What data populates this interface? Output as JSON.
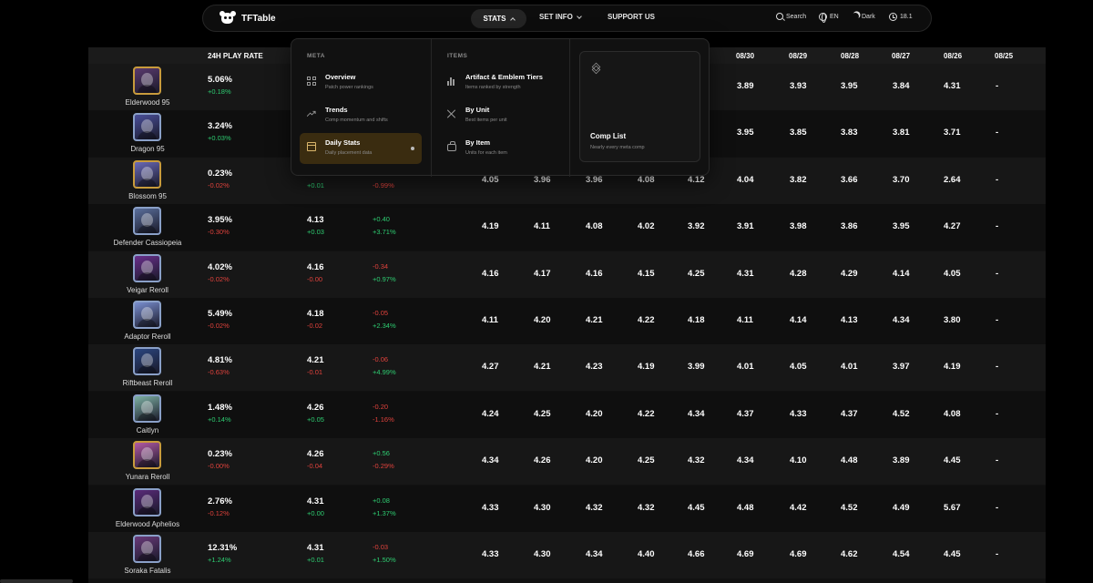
{
  "navbar": {
    "logo": "TFTable",
    "stats": "STATS",
    "set_info": "SET INFO",
    "support": "SUPPORT US",
    "search": "Search",
    "lang": "EN",
    "theme": "Dark",
    "version": "18.1"
  },
  "table": {
    "headers": {
      "play_rate": "24H PLAY RATE",
      "dates": [
        "08/30",
        "08/29",
        "08/28",
        "08/27",
        "08/26",
        "08/25"
      ]
    },
    "rows": [
      {
        "name": "Elderwood 95",
        "play": "5.06%",
        "play_delta": "+0.18%",
        "place": "",
        "place_delta": "",
        "change": "",
        "change_pct": "",
        "d": [
          "",
          "",
          "",
          "",
          "",
          "3.89",
          "3.93",
          "3.95",
          "3.84",
          "4.31",
          "-"
        ]
      },
      {
        "name": "Dragon 95",
        "play": "3.24%",
        "play_delta": "+0.03%",
        "place": "",
        "place_delta": "",
        "change": "",
        "change_pct": "",
        "d": [
          "",
          "",
          "",
          "",
          "",
          "3.95",
          "3.85",
          "3.83",
          "3.81",
          "3.71",
          "-"
        ]
      },
      {
        "name": "Blossom 95",
        "play": "0.23%",
        "play_delta": "-0.02%",
        "place": "",
        "place_delta": "+0.01",
        "change": "",
        "change_pct": "-0.99%",
        "d": [
          "4.05",
          "3.96",
          "3.96",
          "4.08",
          "4.12",
          "4.04",
          "3.82",
          "3.66",
          "3.70",
          "2.64",
          "-"
        ]
      },
      {
        "name": "Defender Cassiopeia",
        "play": "3.95%",
        "play_delta": "-0.30%",
        "place": "4.13",
        "place_delta": "+0.03",
        "change": "+0.40",
        "change_pct": "+3.71%",
        "d": [
          "4.19",
          "4.11",
          "4.08",
          "4.02",
          "3.92",
          "3.91",
          "3.98",
          "3.86",
          "3.95",
          "4.27",
          "-"
        ]
      },
      {
        "name": "Veigar Reroll",
        "play": "4.02%",
        "play_delta": "-0.02%",
        "place": "4.16",
        "place_delta": "-0.00",
        "change": "-0.34",
        "change_pct": "+0.97%",
        "d": [
          "4.16",
          "4.17",
          "4.16",
          "4.15",
          "4.25",
          "4.31",
          "4.28",
          "4.29",
          "4.14",
          "4.05",
          "-"
        ]
      },
      {
        "name": "Adaptor Reroll",
        "play": "5.49%",
        "play_delta": "-0.02%",
        "place": "4.18",
        "place_delta": "-0.02",
        "change": "-0.05",
        "change_pct": "+2.34%",
        "d": [
          "4.11",
          "4.20",
          "4.21",
          "4.22",
          "4.18",
          "4.11",
          "4.14",
          "4.13",
          "4.34",
          "3.80",
          "-"
        ]
      },
      {
        "name": "Riftbeast Reroll",
        "play": "4.81%",
        "play_delta": "-0.63%",
        "place": "4.21",
        "place_delta": "-0.01",
        "change": "-0.06",
        "change_pct": "+4.99%",
        "d": [
          "4.27",
          "4.21",
          "4.23",
          "4.19",
          "3.99",
          "4.01",
          "4.05",
          "4.01",
          "3.97",
          "4.19",
          "-"
        ]
      },
      {
        "name": "Caitlyn",
        "play": "1.48%",
        "play_delta": "+0.14%",
        "place": "4.26",
        "place_delta": "+0.05",
        "change": "-0.20",
        "change_pct": "-1.16%",
        "d": [
          "4.24",
          "4.25",
          "4.20",
          "4.22",
          "4.34",
          "4.37",
          "4.33",
          "4.37",
          "4.52",
          "4.08",
          "-"
        ]
      },
      {
        "name": "Yunara Reroll",
        "play": "0.23%",
        "play_delta": "-0.00%",
        "place": "4.26",
        "place_delta": "-0.04",
        "change": "+0.56",
        "change_pct": "-0.29%",
        "d": [
          "4.34",
          "4.26",
          "4.20",
          "4.25",
          "4.32",
          "4.34",
          "4.10",
          "4.48",
          "3.89",
          "4.45",
          "-"
        ]
      },
      {
        "name": "Elderwood Aphelios",
        "play": "2.76%",
        "play_delta": "-0.12%",
        "place": "4.31",
        "place_delta": "+0.00",
        "change": "+0.08",
        "change_pct": "+1.37%",
        "d": [
          "4.33",
          "4.30",
          "4.32",
          "4.32",
          "4.45",
          "4.48",
          "4.42",
          "4.52",
          "4.49",
          "5.67",
          "-"
        ]
      },
      {
        "name": "Soraka Fatalis",
        "play": "12.31%",
        "play_delta": "+1.24%",
        "place": "4.31",
        "place_delta": "+0.01",
        "change": "-0.03",
        "change_pct": "+1.50%",
        "d": [
          "4.33",
          "4.30",
          "4.34",
          "4.40",
          "4.66",
          "4.69",
          "4.69",
          "4.62",
          "4.54",
          "4.45",
          "-"
        ]
      }
    ],
    "avatar_colors": [
      "#5a3a6e",
      "#4a4f9a",
      "#6a6ab8",
      "#5a6f9c",
      "#6a2f8c",
      "#7a8fd0",
      "#2b4680",
      "#7fb2a5",
      "#b35aa5",
      "#5a2a7a",
      "#6a3a7a"
    ]
  },
  "dropdown": {
    "meta_title": "META",
    "items_title": "ITEMS",
    "meta": [
      {
        "label": "Overview",
        "desc": "Patch power rankings"
      },
      {
        "label": "Trends",
        "desc": "Comp momentum and shifts"
      },
      {
        "label": "Daily Stats",
        "desc": "Daily placement data"
      }
    ],
    "items": [
      {
        "label": "Artifact & Emblem Tiers",
        "desc": "Items ranked by strength"
      },
      {
        "label": "By Unit",
        "desc": "Best items per unit"
      },
      {
        "label": "By Item",
        "desc": "Units for each item"
      }
    ],
    "card": {
      "title": "Comp List",
      "desc": "Nearly every meta comp"
    }
  }
}
